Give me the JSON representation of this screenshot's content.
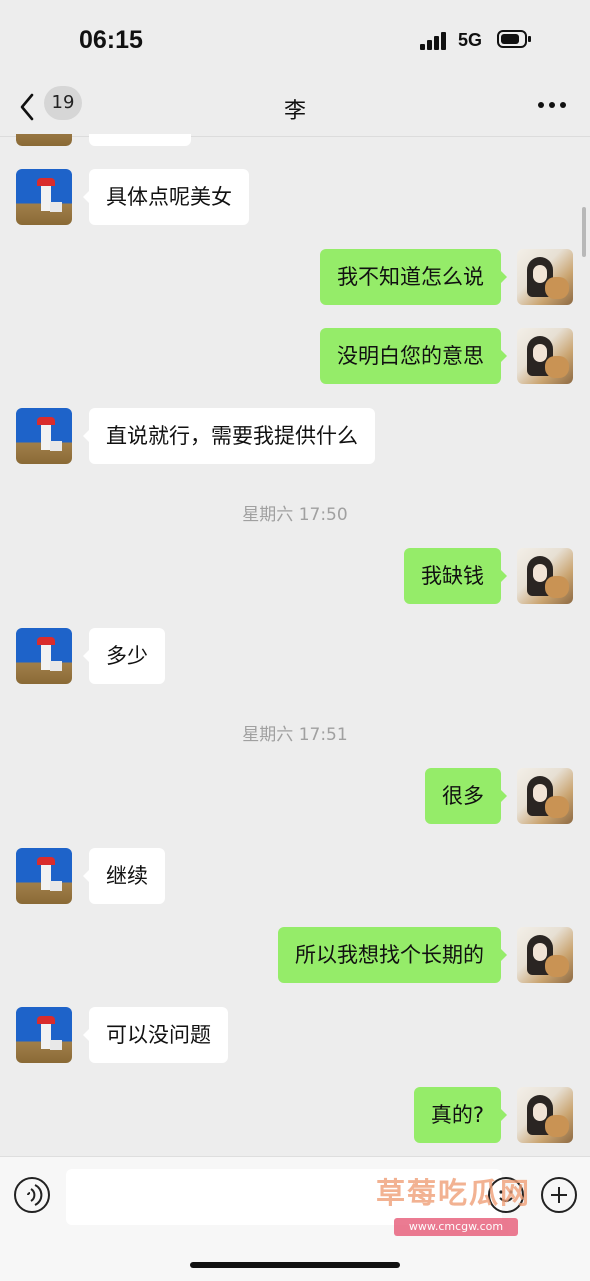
{
  "status_bar": {
    "time": "06:15",
    "network": "5G"
  },
  "nav": {
    "unread_count": "19",
    "title": "李"
  },
  "messages": [
    {
      "side": "left",
      "text": "具体点呢美女"
    },
    {
      "side": "right",
      "text": "我不知道怎么说"
    },
    {
      "side": "right",
      "text": "没明白您的意思"
    },
    {
      "side": "left",
      "text": "直说就行，需要我提供什么"
    },
    {
      "side": "right",
      "text": "我缺钱"
    },
    {
      "side": "left",
      "text": "多少"
    },
    {
      "side": "right",
      "text": "很多"
    },
    {
      "side": "left",
      "text": "继续"
    },
    {
      "side": "right",
      "text": "所以我想找个长期的"
    },
    {
      "side": "left",
      "text": "可以没问题"
    },
    {
      "side": "right",
      "text": "真的?"
    }
  ],
  "timestamps": [
    "星期六 17:50",
    "星期六 17:51"
  ],
  "input": {
    "placeholder": ""
  },
  "watermark": {
    "text": "草莓吃瓜网",
    "sub": "www.cmcgw.com"
  },
  "colors": {
    "sent_bubble": "#95ec69",
    "received_bubble": "#ffffff",
    "background": "#ededed"
  },
  "icons": {
    "back": "chevron-left-icon",
    "more": "ellipsis-icon",
    "voice": "voice-icon",
    "emoji": "emoji-icon",
    "plus": "plus-icon"
  }
}
